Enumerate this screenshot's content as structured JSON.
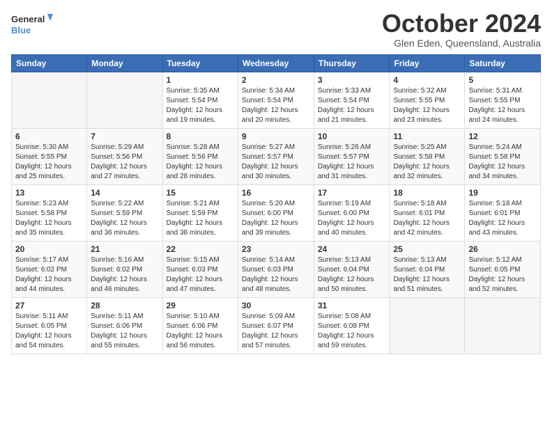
{
  "header": {
    "logo_line1": "General",
    "logo_line2": "Blue",
    "month_title": "October 2024",
    "subtitle": "Glen Eden, Queensland, Australia"
  },
  "weekdays": [
    "Sunday",
    "Monday",
    "Tuesday",
    "Wednesday",
    "Thursday",
    "Friday",
    "Saturday"
  ],
  "weeks": [
    [
      {
        "day": "",
        "sunrise": "",
        "sunset": "",
        "daylight": ""
      },
      {
        "day": "",
        "sunrise": "",
        "sunset": "",
        "daylight": ""
      },
      {
        "day": "1",
        "sunrise": "Sunrise: 5:35 AM",
        "sunset": "Sunset: 5:54 PM",
        "daylight": "Daylight: 12 hours and 19 minutes."
      },
      {
        "day": "2",
        "sunrise": "Sunrise: 5:34 AM",
        "sunset": "Sunset: 5:54 PM",
        "daylight": "Daylight: 12 hours and 20 minutes."
      },
      {
        "day": "3",
        "sunrise": "Sunrise: 5:33 AM",
        "sunset": "Sunset: 5:54 PM",
        "daylight": "Daylight: 12 hours and 21 minutes."
      },
      {
        "day": "4",
        "sunrise": "Sunrise: 5:32 AM",
        "sunset": "Sunset: 5:55 PM",
        "daylight": "Daylight: 12 hours and 23 minutes."
      },
      {
        "day": "5",
        "sunrise": "Sunrise: 5:31 AM",
        "sunset": "Sunset: 5:55 PM",
        "daylight": "Daylight: 12 hours and 24 minutes."
      }
    ],
    [
      {
        "day": "6",
        "sunrise": "Sunrise: 5:30 AM",
        "sunset": "Sunset: 5:55 PM",
        "daylight": "Daylight: 12 hours and 25 minutes."
      },
      {
        "day": "7",
        "sunrise": "Sunrise: 5:29 AM",
        "sunset": "Sunset: 5:56 PM",
        "daylight": "Daylight: 12 hours and 27 minutes."
      },
      {
        "day": "8",
        "sunrise": "Sunrise: 5:28 AM",
        "sunset": "Sunset: 5:56 PM",
        "daylight": "Daylight: 12 hours and 28 minutes."
      },
      {
        "day": "9",
        "sunrise": "Sunrise: 5:27 AM",
        "sunset": "Sunset: 5:57 PM",
        "daylight": "Daylight: 12 hours and 30 minutes."
      },
      {
        "day": "10",
        "sunrise": "Sunrise: 5:26 AM",
        "sunset": "Sunset: 5:57 PM",
        "daylight": "Daylight: 12 hours and 31 minutes."
      },
      {
        "day": "11",
        "sunrise": "Sunrise: 5:25 AM",
        "sunset": "Sunset: 5:58 PM",
        "daylight": "Daylight: 12 hours and 32 minutes."
      },
      {
        "day": "12",
        "sunrise": "Sunrise: 5:24 AM",
        "sunset": "Sunset: 5:58 PM",
        "daylight": "Daylight: 12 hours and 34 minutes."
      }
    ],
    [
      {
        "day": "13",
        "sunrise": "Sunrise: 5:23 AM",
        "sunset": "Sunset: 5:58 PM",
        "daylight": "Daylight: 12 hours and 35 minutes."
      },
      {
        "day": "14",
        "sunrise": "Sunrise: 5:22 AM",
        "sunset": "Sunset: 5:59 PM",
        "daylight": "Daylight: 12 hours and 36 minutes."
      },
      {
        "day": "15",
        "sunrise": "Sunrise: 5:21 AM",
        "sunset": "Sunset: 5:59 PM",
        "daylight": "Daylight: 12 hours and 38 minutes."
      },
      {
        "day": "16",
        "sunrise": "Sunrise: 5:20 AM",
        "sunset": "Sunset: 6:00 PM",
        "daylight": "Daylight: 12 hours and 39 minutes."
      },
      {
        "day": "17",
        "sunrise": "Sunrise: 5:19 AM",
        "sunset": "Sunset: 6:00 PM",
        "daylight": "Daylight: 12 hours and 40 minutes."
      },
      {
        "day": "18",
        "sunrise": "Sunrise: 5:18 AM",
        "sunset": "Sunset: 6:01 PM",
        "daylight": "Daylight: 12 hours and 42 minutes."
      },
      {
        "day": "19",
        "sunrise": "Sunrise: 5:18 AM",
        "sunset": "Sunset: 6:01 PM",
        "daylight": "Daylight: 12 hours and 43 minutes."
      }
    ],
    [
      {
        "day": "20",
        "sunrise": "Sunrise: 5:17 AM",
        "sunset": "Sunset: 6:02 PM",
        "daylight": "Daylight: 12 hours and 44 minutes."
      },
      {
        "day": "21",
        "sunrise": "Sunrise: 5:16 AM",
        "sunset": "Sunset: 6:02 PM",
        "daylight": "Daylight: 12 hours and 46 minutes."
      },
      {
        "day": "22",
        "sunrise": "Sunrise: 5:15 AM",
        "sunset": "Sunset: 6:03 PM",
        "daylight": "Daylight: 12 hours and 47 minutes."
      },
      {
        "day": "23",
        "sunrise": "Sunrise: 5:14 AM",
        "sunset": "Sunset: 6:03 PM",
        "daylight": "Daylight: 12 hours and 48 minutes."
      },
      {
        "day": "24",
        "sunrise": "Sunrise: 5:13 AM",
        "sunset": "Sunset: 6:04 PM",
        "daylight": "Daylight: 12 hours and 50 minutes."
      },
      {
        "day": "25",
        "sunrise": "Sunrise: 5:13 AM",
        "sunset": "Sunset: 6:04 PM",
        "daylight": "Daylight: 12 hours and 51 minutes."
      },
      {
        "day": "26",
        "sunrise": "Sunrise: 5:12 AM",
        "sunset": "Sunset: 6:05 PM",
        "daylight": "Daylight: 12 hours and 52 minutes."
      }
    ],
    [
      {
        "day": "27",
        "sunrise": "Sunrise: 5:11 AM",
        "sunset": "Sunset: 6:05 PM",
        "daylight": "Daylight: 12 hours and 54 minutes."
      },
      {
        "day": "28",
        "sunrise": "Sunrise: 5:11 AM",
        "sunset": "Sunset: 6:06 PM",
        "daylight": "Daylight: 12 hours and 55 minutes."
      },
      {
        "day": "29",
        "sunrise": "Sunrise: 5:10 AM",
        "sunset": "Sunset: 6:06 PM",
        "daylight": "Daylight: 12 hours and 56 minutes."
      },
      {
        "day": "30",
        "sunrise": "Sunrise: 5:09 AM",
        "sunset": "Sunset: 6:07 PM",
        "daylight": "Daylight: 12 hours and 57 minutes."
      },
      {
        "day": "31",
        "sunrise": "Sunrise: 5:08 AM",
        "sunset": "Sunset: 6:08 PM",
        "daylight": "Daylight: 12 hours and 59 minutes."
      },
      {
        "day": "",
        "sunrise": "",
        "sunset": "",
        "daylight": ""
      },
      {
        "day": "",
        "sunrise": "",
        "sunset": "",
        "daylight": ""
      }
    ]
  ]
}
